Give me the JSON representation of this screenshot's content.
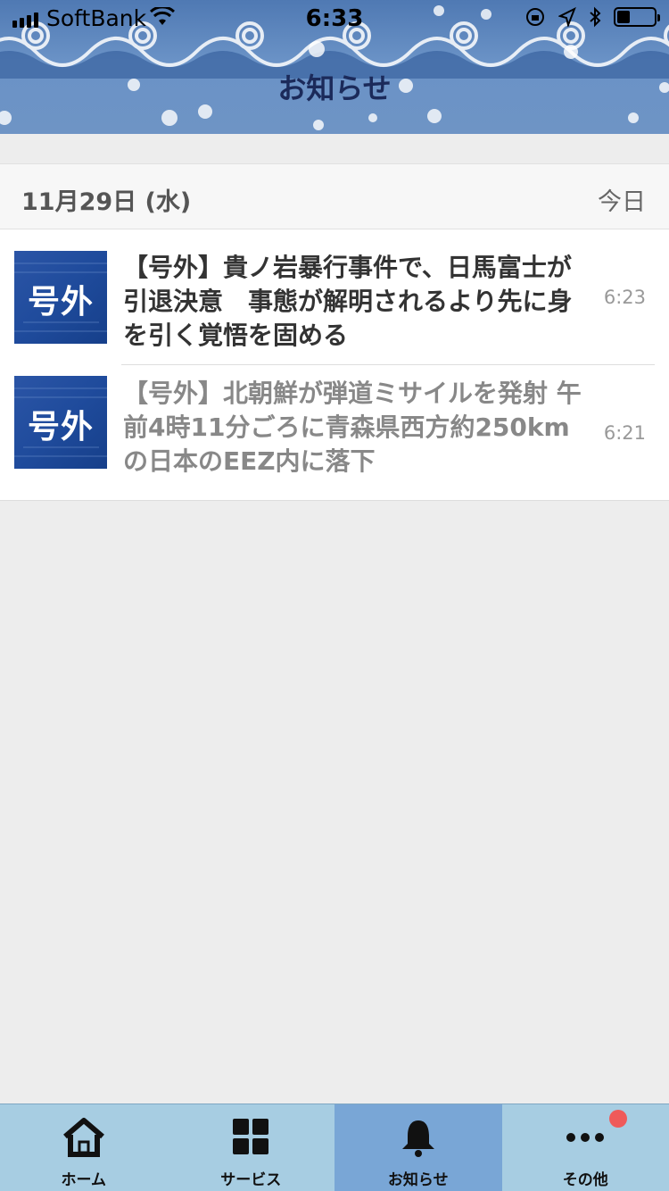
{
  "status_bar": {
    "carrier": "SoftBank",
    "time": "6:33"
  },
  "header": {
    "title": "お知らせ"
  },
  "date_section": {
    "date": "11月29日 (水)",
    "relative": "今日"
  },
  "notices": [
    {
      "thumb_label": "号外",
      "title": "【号外】貴ノ岩暴行事件で、日馬富士が引退決意　事態が解明されるより先に身を引く覚悟を固める",
      "time": "6:23",
      "read": false
    },
    {
      "thumb_label": "号外",
      "title": "【号外】北朝鮮が弾道ミサイルを発射 午前4時11分ごろに青森県西方約250kmの日本のEEZ内に落下",
      "time": "6:21",
      "read": true
    }
  ],
  "tabs": [
    {
      "label": "ホーム",
      "icon": "home-icon"
    },
    {
      "label": "サービス",
      "icon": "grid-icon"
    },
    {
      "label": "お知らせ",
      "icon": "bell-icon",
      "active": true
    },
    {
      "label": "その他",
      "icon": "more-icon",
      "badge": true
    }
  ],
  "colors": {
    "header_blue": "#5f88bf",
    "title_navy": "#1b2a5a",
    "tab_bar": "#a7cde2",
    "tab_active": "#79a6d6",
    "badge_red": "#ef5a5a",
    "read_text": "#888888",
    "unread_text": "#333333"
  }
}
